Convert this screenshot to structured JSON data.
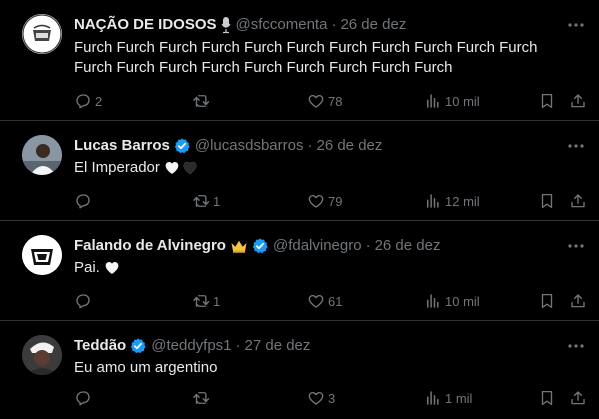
{
  "tweets": [
    {
      "name": "NAÇÃO DE IDOSOS",
      "name_emoji": "microphone-icon",
      "verified": false,
      "handle": "@sfccomenta",
      "date": "26 de dez",
      "text_lines": [
        "Furch Furch Furch Furch Furch Furch Furch Furch Furch Furch Furch",
        "Furch Furch Furch Furch Furch Furch Furch Furch Furch"
      ],
      "replies": "2",
      "reposts": "",
      "likes": "78",
      "views": "10 mil"
    },
    {
      "name": "Lucas Barros",
      "verified": true,
      "handle": "@lucasdsbarros",
      "date": "26 de dez",
      "text": "El Imperador",
      "text_emojis": [
        "white-heart-icon",
        "black-heart-icon"
      ],
      "replies": "",
      "reposts": "1",
      "likes": "79",
      "views": "12 mil"
    },
    {
      "name": "Falando de Alvinegro",
      "name_emoji": "crown-icon",
      "verified": true,
      "handle": "@fdalvinegro",
      "date": "26 de dez",
      "text": "Pai.",
      "text_emojis": [
        "white-heart-icon"
      ],
      "replies": "",
      "reposts": "1",
      "likes": "61",
      "views": "10 mil"
    },
    {
      "name": "Teddão",
      "verified": true,
      "handle": "@teddyfps1",
      "date": "27 de dez",
      "text": "Eu amo um argentino",
      "replies": "",
      "reposts": "",
      "likes": "3",
      "views": "1 mil"
    }
  ],
  "colors": {
    "background": "#000000",
    "text": "#e7e9ea",
    "muted": "#71767b",
    "divider": "#2f3336",
    "verified": "#1d9bf0",
    "crown": "#f4c542"
  }
}
